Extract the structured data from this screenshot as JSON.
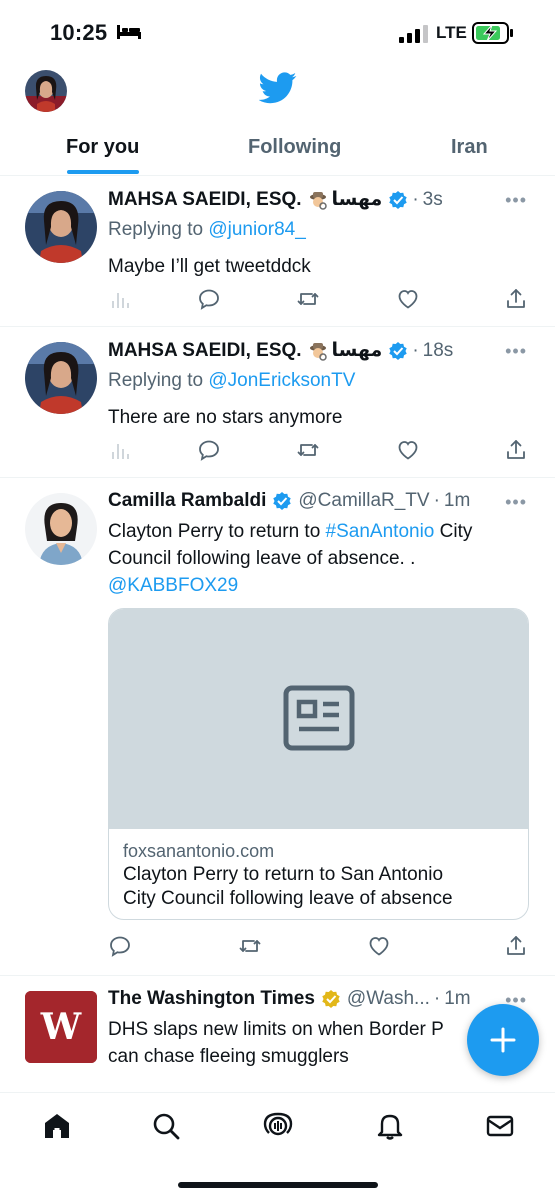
{
  "status": {
    "time": "10:25",
    "network": "LTE"
  },
  "tabs": [
    {
      "label": "For you"
    },
    {
      "label": "Following"
    },
    {
      "label": "Iran"
    }
  ],
  "tweets": [
    {
      "name": "MAHSA SAEIDI, ESQ.",
      "arabic": "مهسا",
      "verified": true,
      "time": "3s",
      "replying_label": "Replying to",
      "replying_to": "@junior84_",
      "text": "Maybe I’ll get tweetddck"
    },
    {
      "name": "MAHSA SAEIDI, ESQ.",
      "arabic": "مهسا",
      "verified": true,
      "time": "18s",
      "replying_label": "Replying to",
      "replying_to": "@JonEricksonTV",
      "text": "There are no stars anymore"
    },
    {
      "name": "Camilla Rambaldi",
      "handle": "@CamillaR_TV",
      "verified": true,
      "time": "1m",
      "text_line1_pre": "Clayton Perry to return to ",
      "hashtag": "#SanAntonio",
      "text_line1_post": " City",
      "text_line2": "Council following leave of absence. .",
      "mention": "@KABBFOX29",
      "card": {
        "domain": "foxsanantonio.com",
        "title_line1": "Clayton Perry to return to San Antonio",
        "title_line2": "City Council following leave of absence"
      }
    },
    {
      "name": "The Washington Times",
      "handle": "@Wash...",
      "verified_gold": true,
      "time": "1m",
      "text_line1": "DHS slaps new limits on when Border P",
      "text_line2": "can chase fleeing smugglers"
    }
  ],
  "colors": {
    "accent": "#1d9bf0",
    "gold": "#e2b719",
    "wt_red": "#a4262c"
  },
  "icons": [
    "bed-icon",
    "signal-icon",
    "battery-charging-icon",
    "twitter-bird-icon",
    "more-icon",
    "reply-icon",
    "retweet-icon",
    "like-icon",
    "share-icon",
    "views-icon",
    "compose-icon",
    "home-icon",
    "search-icon",
    "spaces-icon",
    "bell-icon",
    "mail-icon"
  ]
}
